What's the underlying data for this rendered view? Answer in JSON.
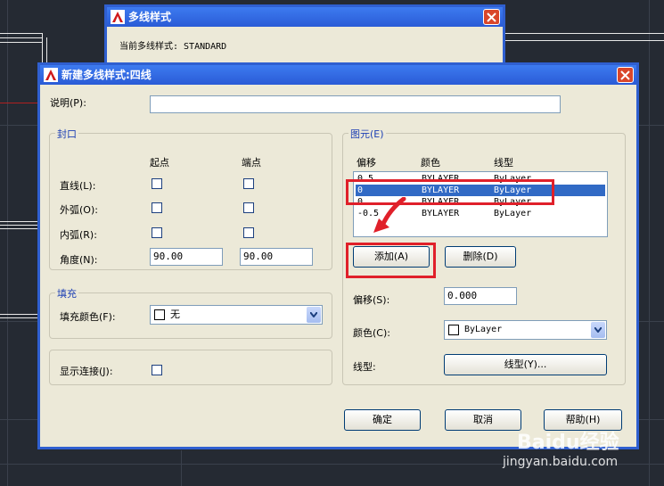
{
  "bg_dialog": {
    "title": "多线样式",
    "current_style_label": "当前多线样式: STANDARD"
  },
  "dialog": {
    "title": "新建多线样式:四线",
    "description_label": "说明(P):",
    "description_value": "",
    "caps": {
      "title": "封口",
      "col_start": "起点",
      "col_end": "端点",
      "rows": [
        {
          "label": "直线(L):"
        },
        {
          "label": "外弧(O):"
        },
        {
          "label": "内弧(R):"
        }
      ],
      "angle_label": "角度(N):",
      "angle_start": "90.00",
      "angle_end": "90.00"
    },
    "fill": {
      "title": "填充",
      "fill_color_label": "填充颜色(F):",
      "fill_color_value": "无"
    },
    "show_joints_label": "显示连接(J):",
    "elements": {
      "title": "图元(E)",
      "col_offset": "偏移",
      "col_color": "颜色",
      "col_linetype": "线型",
      "rows": [
        {
          "offset": "0.5",
          "color": "BYLAYER",
          "linetype": "ByLayer"
        },
        {
          "offset": "0",
          "color": "BYLAYER",
          "linetype": "ByLayer"
        },
        {
          "offset": "0",
          "color": "BYLAYER",
          "linetype": "ByLayer"
        },
        {
          "offset": "-0.5",
          "color": "BYLAYER",
          "linetype": "ByLayer"
        }
      ],
      "add_button": "添加(A)",
      "delete_button": "删除(D)",
      "offset_label": "偏移(S):",
      "offset_value": "0.000",
      "color_label": "颜色(C):",
      "color_value": "ByLayer",
      "linetype_label": "线型:",
      "linetype_button": "线型(Y)..."
    },
    "ok_button": "确定",
    "cancel_button": "取消",
    "help_button": "帮助(H)"
  },
  "watermark": {
    "brand": "Baidu经验",
    "url": "jingyan.baidu.com"
  },
  "colors": {
    "highlight": "#e0202a",
    "title_blue": "#2a5bd6",
    "group_title": "#1c3fb4",
    "selection": "#316ac5"
  }
}
